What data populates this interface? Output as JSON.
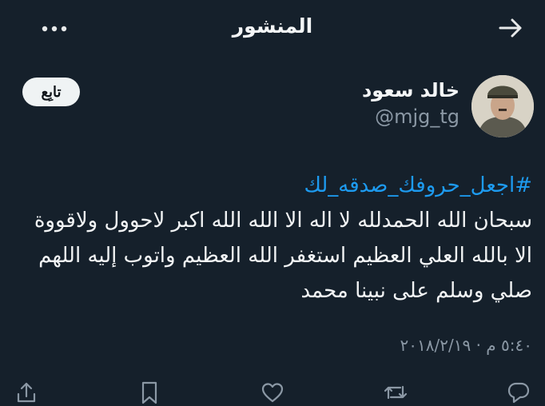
{
  "header": {
    "title": "المنشور",
    "back_icon": "arrow-right-icon",
    "more_icon": "more-dots-icon"
  },
  "author": {
    "name": "خالد سعود",
    "handle": "@mjg_tg",
    "avatar_icon": "profile-avatar"
  },
  "follow_button": {
    "label": "تابِع"
  },
  "tweet": {
    "hashtag": "#اجعل_حروفك_صدقه_لك",
    "lines": [
      "سبحان الله الحمدلله لا اله الا الله الله اكبر لاحوول ولاقووة",
      "الا بالله العلي العظيم استغفر الله العظيم واتوب إليه اللهم",
      "صلي وسلم على نبينا محمد"
    ],
    "timestamp": "٥:٤٠ م · ٢٠١٨/٢/١٩"
  },
  "actions": {
    "reply_icon": "reply-icon",
    "retweet_icon": "retweet-icon",
    "like_icon": "heart-icon",
    "bookmark_icon": "bookmark-icon",
    "share_icon": "share-icon"
  },
  "colors": {
    "background": "#15202b",
    "text": "#e7e9ea",
    "secondary": "#8b98a5",
    "link": "#1d9bf0"
  }
}
